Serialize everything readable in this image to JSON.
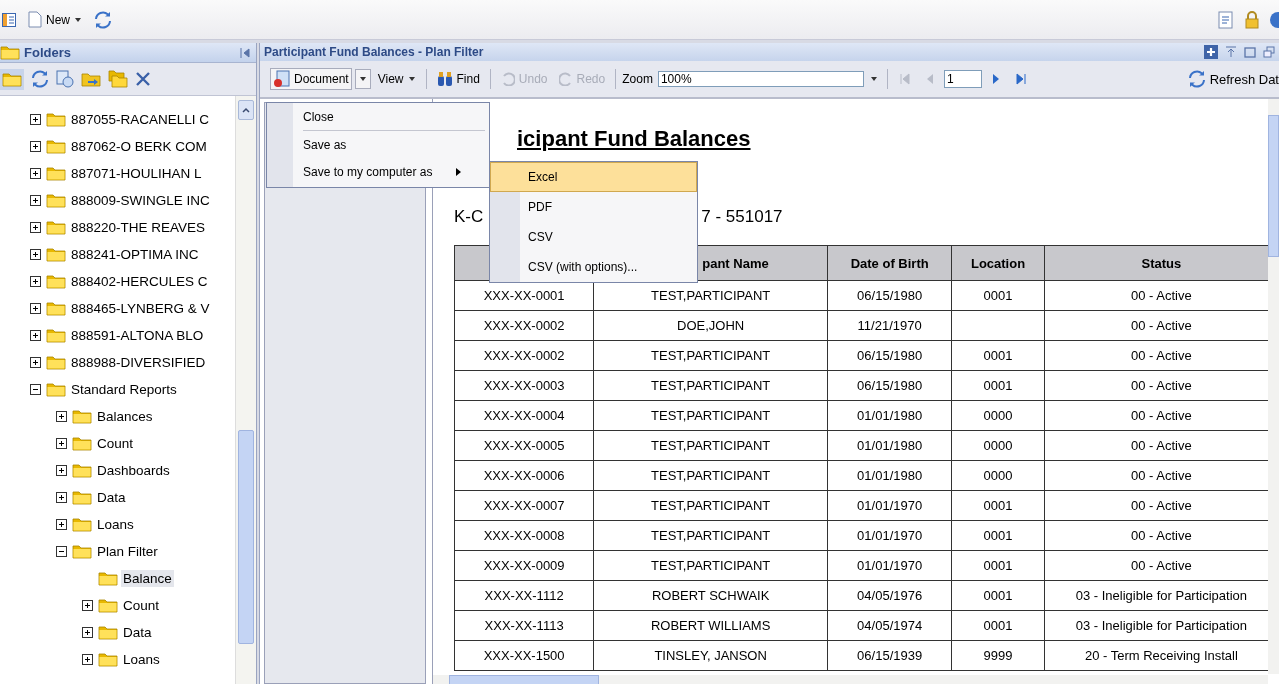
{
  "app_toolbar": {
    "new_label": "New"
  },
  "folders_panel": {
    "title": "Folders",
    "tree": [
      {
        "label": "887055-RACANELLI C",
        "kind": "folder",
        "expanded": false,
        "selected": false
      },
      {
        "label": "887062-O BERK COM",
        "kind": "folder",
        "expanded": false,
        "selected": false
      },
      {
        "label": "887071-HOULIHAN L",
        "kind": "folder",
        "expanded": false,
        "selected": false
      },
      {
        "label": "888009-SWINGLE INC",
        "kind": "folder",
        "expanded": false,
        "selected": false
      },
      {
        "label": "888220-THE REAVES",
        "kind": "folder",
        "expanded": false,
        "selected": false
      },
      {
        "label": "888241-OPTIMA INC",
        "kind": "folder",
        "expanded": false,
        "selected": false
      },
      {
        "label": "888402-HERCULES C",
        "kind": "folder",
        "expanded": false,
        "selected": false
      },
      {
        "label": "888465-LYNBERG & V",
        "kind": "folder",
        "expanded": false,
        "selected": false
      },
      {
        "label": "888591-ALTONA BLO",
        "kind": "folder",
        "expanded": false,
        "selected": false
      },
      {
        "label": "888988-DIVERSIFIED",
        "kind": "folder",
        "expanded": false,
        "selected": false
      },
      {
        "label": "Standard Reports",
        "kind": "folder",
        "expanded": true,
        "selected": false,
        "children": [
          {
            "label": "Balances",
            "kind": "folder",
            "expanded": false,
            "selected": false
          },
          {
            "label": "Count",
            "kind": "folder",
            "expanded": false,
            "selected": false
          },
          {
            "label": "Dashboards",
            "kind": "folder",
            "expanded": false,
            "selected": false
          },
          {
            "label": "Data",
            "kind": "folder",
            "expanded": false,
            "selected": false
          },
          {
            "label": "Loans",
            "kind": "folder",
            "expanded": false,
            "selected": false
          },
          {
            "label": "Plan Filter",
            "kind": "folder",
            "expanded": true,
            "selected": false,
            "children": [
              {
                "label": "Balance",
                "kind": "report",
                "selected": true
              },
              {
                "label": "Count",
                "kind": "folder",
                "expanded": false,
                "selected": false
              },
              {
                "label": "Data",
                "kind": "folder",
                "expanded": false,
                "selected": false
              },
              {
                "label": "Loans",
                "kind": "folder",
                "expanded": false,
                "selected": false
              }
            ]
          }
        ]
      }
    ]
  },
  "report_window": {
    "title": "Participant Fund Balances - Plan Filter",
    "toolbar": {
      "document": "Document",
      "view": "View",
      "find": "Find",
      "undo": {
        "label": "Undo",
        "disabled": true
      },
      "redo": {
        "label": "Redo",
        "disabled": true
      },
      "zoom_label": "Zoom",
      "zoom_value": "100%",
      "page_value": "1",
      "nav": [
        {
          "kind": "first",
          "disabled": true
        },
        {
          "kind": "prev",
          "disabled": true
        },
        {
          "kind": "next",
          "disabled": false
        },
        {
          "kind": "last",
          "disabled": false
        }
      ],
      "refresh": "Refresh Dat"
    }
  },
  "document_menu": {
    "items": [
      {
        "label": "Close",
        "separator_after": true,
        "has_submenu": false
      },
      {
        "label": "Save as",
        "separator_after": false,
        "has_submenu": false
      },
      {
        "label": "Save to my computer as",
        "separator_after": false,
        "has_submenu": true
      }
    ],
    "submenu": [
      {
        "label": "Excel",
        "selected": true
      },
      {
        "label": "PDF",
        "selected": false
      },
      {
        "label": "CSV",
        "selected": false
      },
      {
        "label": "CSV (with options)...",
        "selected": false
      }
    ]
  },
  "report": {
    "title": "icipant Fund Balances",
    "subtitle_parts": [
      "K-C",
      "7 - 551017"
    ],
    "columns": [
      "",
      "pant Name",
      "Date of Birth",
      "Location",
      "Status"
    ],
    "rows": [
      [
        "XXX-XX-0001",
        "TEST,PARTICIPANT",
        "06/15/1980",
        "0001",
        "00 - Active"
      ],
      [
        "XXX-XX-0002",
        "DOE,JOHN",
        "11/21/1970",
        "",
        "00 - Active"
      ],
      [
        "XXX-XX-0002",
        "TEST,PARTICIPANT",
        "06/15/1980",
        "0001",
        "00 - Active"
      ],
      [
        "XXX-XX-0003",
        "TEST,PARTICIPANT",
        "06/15/1980",
        "0001",
        "00 - Active"
      ],
      [
        "XXX-XX-0004",
        "TEST,PARTICIPANT",
        "01/01/1980",
        "0000",
        "00 - Active"
      ],
      [
        "XXX-XX-0005",
        "TEST,PARTICIPANT",
        "01/01/1980",
        "0000",
        "00 - Active"
      ],
      [
        "XXX-XX-0006",
        "TEST,PARTICIPANT",
        "01/01/1980",
        "0000",
        "00 - Active"
      ],
      [
        "XXX-XX-0007",
        "TEST,PARTICIPANT",
        "01/01/1970",
        "0001",
        "00 - Active"
      ],
      [
        "XXX-XX-0008",
        "TEST,PARTICIPANT",
        "01/01/1970",
        "0001",
        "00 - Active"
      ],
      [
        "XXX-XX-0009",
        "TEST,PARTICIPANT",
        "01/01/1970",
        "0001",
        "00 - Active"
      ],
      [
        "XXX-XX-1112",
        "ROBERT SCHWAIK",
        "04/05/1976",
        "0001",
        "03 - Ineligible for Participation"
      ],
      [
        "XXX-XX-1113",
        "ROBERT WILLIAMS",
        "04/05/1974",
        "0001",
        "03 - Ineligible for Participation"
      ],
      [
        "XXX-XX-1500",
        "TINSLEY, JANSON",
        "06/15/1939",
        "9999",
        "20 - Term Receiving Install"
      ]
    ]
  }
}
